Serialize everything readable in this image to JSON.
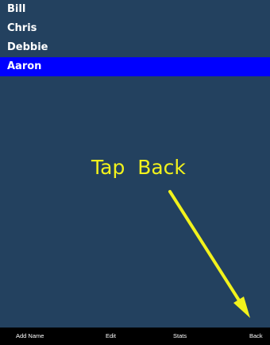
{
  "names": [
    "Bill",
    "Chris",
    "Debbie",
    "Aaron"
  ],
  "selected_name": "Aaron",
  "instruction": "Tap  Back",
  "toolbar": {
    "add_name": "Add Name",
    "edit": "Edit",
    "stats": "Stats",
    "back": "Back"
  },
  "colors": {
    "background": "#23415f",
    "selection": "#0000ff",
    "instruction": "#f2f21c",
    "toolbar": "#000000"
  },
  "icons": {
    "arrow": "arrow-down-right-icon"
  }
}
